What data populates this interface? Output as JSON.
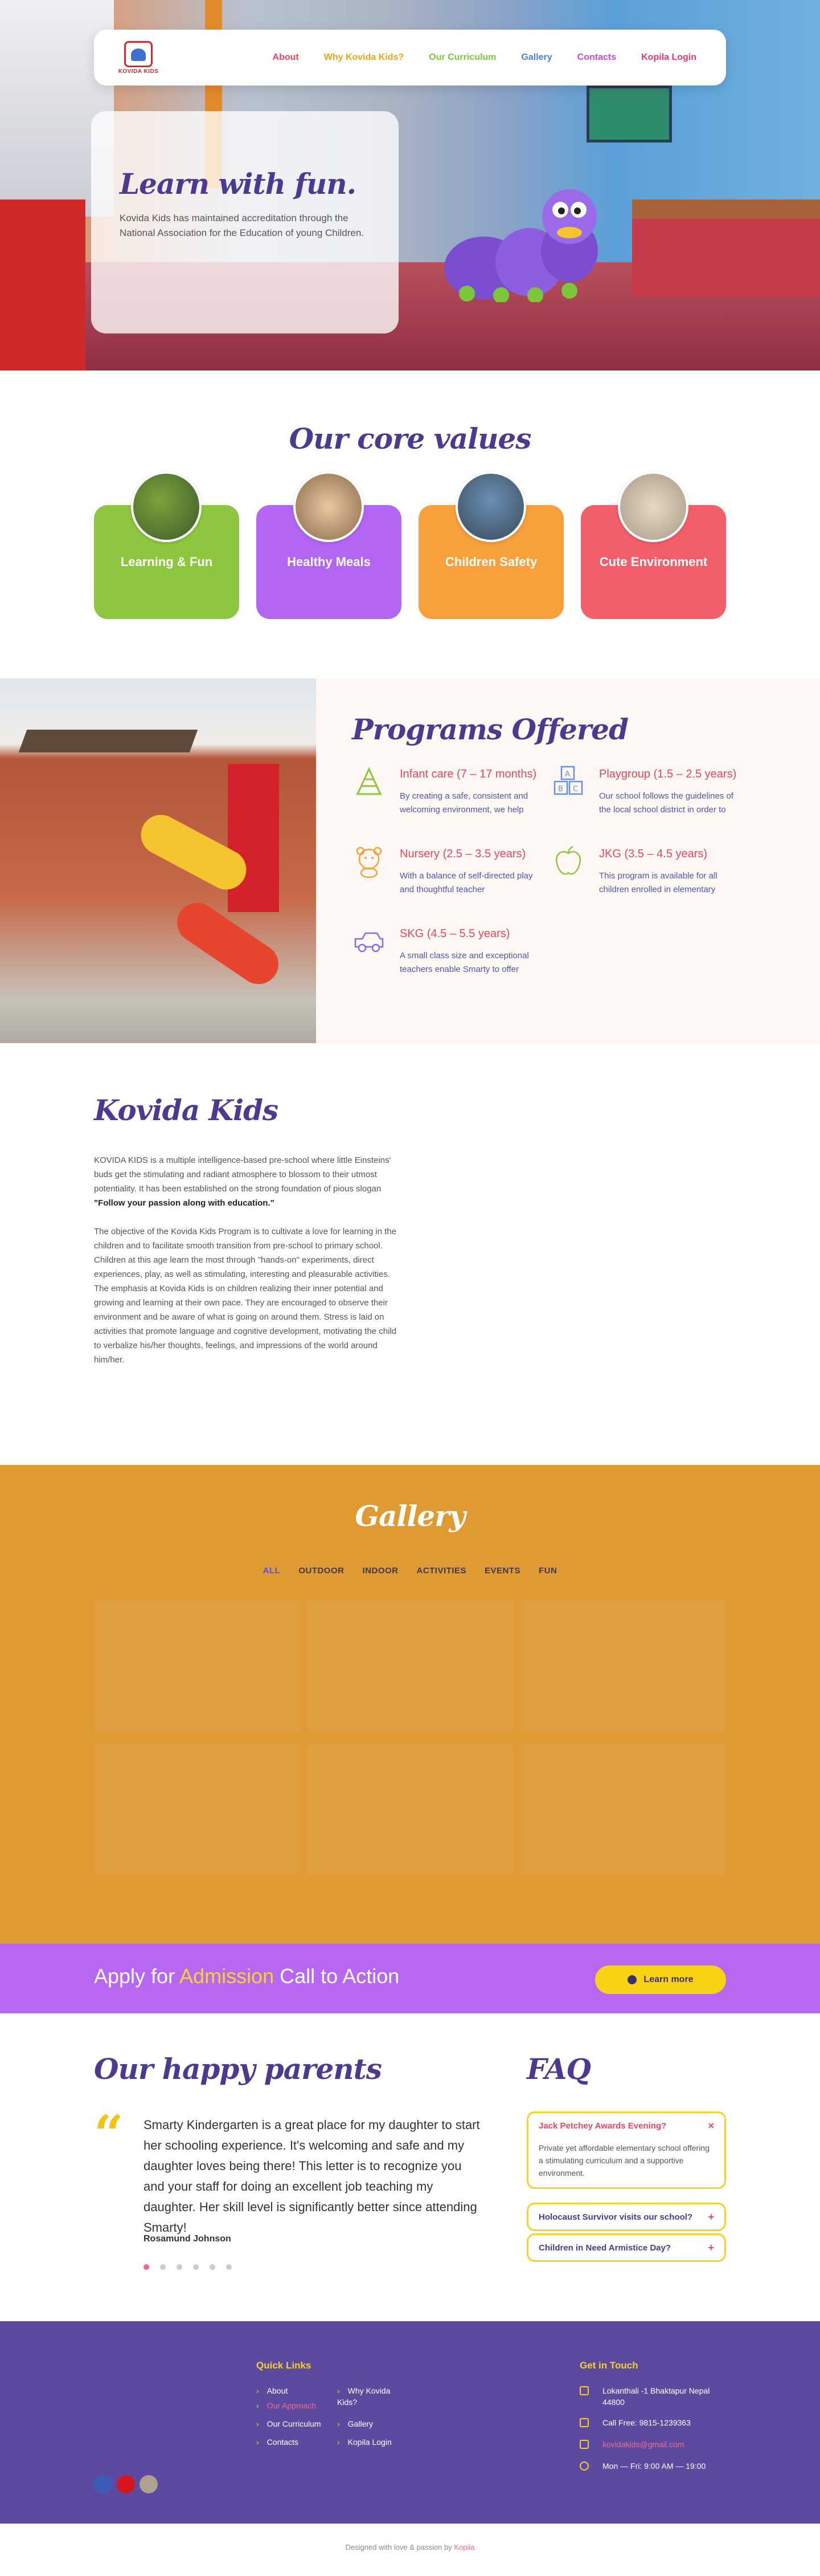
{
  "nav": {
    "logo_text": "KOVIDA KIDS",
    "items": [
      {
        "label": "About",
        "color": "#e8465a"
      },
      {
        "label": "Why Kovida Kids?",
        "color": "#e9a41a"
      },
      {
        "label": "Our Curriculum",
        "color": "#7cc63b"
      },
      {
        "label": "Gallery",
        "color": "#4c7fe0"
      },
      {
        "label": "Contacts",
        "color": "#c44bd6"
      },
      {
        "label": "Kopila Login",
        "color": "#e6357a"
      }
    ]
  },
  "hero": {
    "title": "Learn with fun.",
    "text": "Kovida Kids has maintained accreditation through the National Association for the Education of young Children."
  },
  "core_values": {
    "title": "Our core values",
    "cards": [
      {
        "label": "Learning & Fun",
        "color": "#8dc63f"
      },
      {
        "label": "Healthy Meals",
        "color": "#b366f4"
      },
      {
        "label": "Children Safety",
        "color": "#f7a03c"
      },
      {
        "label": "Cute Environment",
        "color": "#f35e6b"
      }
    ]
  },
  "programs": {
    "title": "Programs Offered",
    "items": [
      {
        "title": "Infant care (7 – 17 months)",
        "desc": "By creating a safe, consistent and welcoming environment, we help",
        "icon": "abacus-icon"
      },
      {
        "title": "Playgroup (1.5 – 2.5 years)",
        "desc": "Our school follows the guidelines of the local school district in order to",
        "icon": "abc-blocks-icon"
      },
      {
        "title": "Nursery (2.5 – 3.5 years)",
        "desc": "With a balance of self-directed play and thoughtful teacher",
        "icon": "teddy-bear-icon"
      },
      {
        "title": "JKG (3.5 – 4.5 years)",
        "desc": "This program is available for all children enrolled in elementary",
        "icon": "apple-icon"
      },
      {
        "title": "SKG (4.5 – 5.5 years)",
        "desc": "A small class size and exceptional teachers enable Smarty to offer",
        "icon": "toy-car-icon"
      }
    ]
  },
  "about": {
    "title": "Kovida Kids",
    "p1": "KOVIDA KIDS is a multiple intelligence-based pre-school where little Einsteins' buds get the stimulating and radiant atmosphere to blossom to their utmost potentiality. It has been established on the strong foundation of pious slogan",
    "slogan": "\"Follow your passion along with education.\"",
    "p2": "The objective of the Kovida Kids Program is to cultivate a love for learning in the children and to facilitate smooth transition from pre-school to primary school. Children at this age learn the most through \"hands-on\" experiments, direct experiences, play, as well as stimulating, interesting and pleasurable activities. The emphasis at Kovida Kids is on children realizing their inner potential and growing and learning at their own pace. They are encouraged to observe their environment and be aware of what is going on around them. Stress is laid on activities that promote language and cognitive development, motivating the child to verbalize his/her thoughts, feelings, and impressions of the world around him/her."
  },
  "gallery": {
    "title": "Gallery",
    "tabs": [
      "ALL",
      "OUTDOOR",
      "INDOOR",
      "ACTIVITIES",
      "EVENTS",
      "FUN"
    ]
  },
  "cta": {
    "pre": "Apply for ",
    "highlight": "Admission",
    "post": " Call to Action",
    "button": "Learn more"
  },
  "parents": {
    "title": "Our happy parents",
    "quote": "Smarty Kindergarten is a great place for my daughter to start her schooling experience. It's welcoming and safe and my daughter loves being there! This letter is to recognize you and your staff for doing an excellent job teaching my daughter. Her skill level is significantly better since attending Smarty!",
    "name": "Rosamund Johnson",
    "slides": 6,
    "active_slide": 1
  },
  "faq": {
    "title": "FAQ",
    "items": [
      {
        "q": "Jack Petchey Awards Evening?",
        "a": "Private yet affordable elementary school offering a stimulating curriculum and a supportive environment.",
        "open": true,
        "sign": "×"
      },
      {
        "q": "Holocaust Survivor visits our school?",
        "a": "",
        "open": false,
        "sign": "+"
      },
      {
        "q": "Children in Need Armistice Day?",
        "a": "",
        "open": false,
        "sign": "+"
      }
    ]
  },
  "footer": {
    "quick_links_title": "Quick Links",
    "links_col1": [
      "About",
      "Our Approach",
      "Our Curriculum",
      "Contacts"
    ],
    "links_col2": [
      "Why Kovida Kids?",
      "Gallery",
      "Kopila Login"
    ],
    "contact_title": "Get in Touch",
    "address": "Lokanthali -1 Bhaktapur Nepal 44800",
    "phone": "Call Free: 9815-1239363",
    "email": "kovidakids@gmail.com",
    "hours": "Mon — Fri: 9:00 AM — 19:00",
    "social_colors": [
      "#3b5db5",
      "#d8141c",
      "#b0a090"
    ],
    "copyright_pre": "Designed with love & passion by ",
    "copyright_brand": "Kopila"
  }
}
